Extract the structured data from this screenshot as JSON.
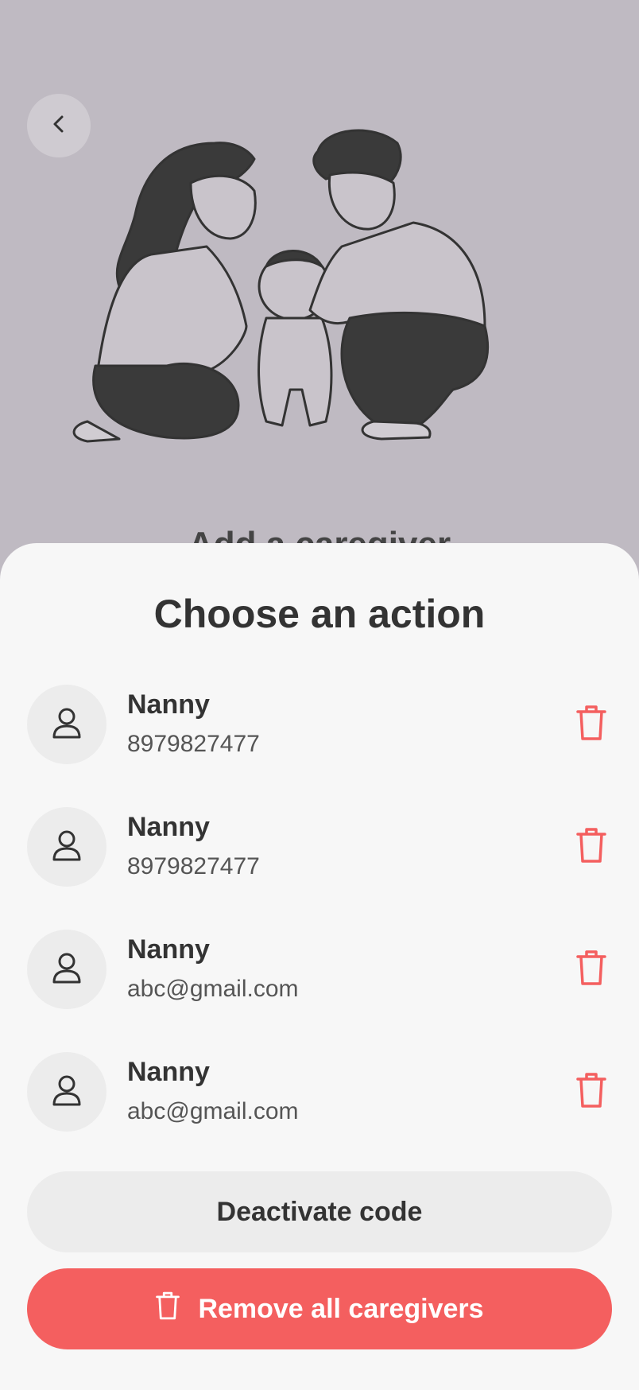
{
  "hero": {
    "background_title": "Add a caregiver"
  },
  "sheet": {
    "title": "Choose an action",
    "caregivers": [
      {
        "name": "Nanny",
        "contact": "8979827477"
      },
      {
        "name": "Nanny",
        "contact": "8979827477"
      },
      {
        "name": "Nanny",
        "contact": "abc@gmail.com"
      },
      {
        "name": "Nanny",
        "contact": "abc@gmail.com"
      }
    ],
    "deactivate_label": "Deactivate code",
    "remove_all_label": "Remove all caregivers"
  },
  "icons": {
    "back": "chevron-left-icon",
    "avatar": "user-icon",
    "delete": "trash-icon"
  },
  "colors": {
    "backdrop": "#bfbac2",
    "sheet": "#f7f7f7",
    "danger": "#f45f5f",
    "secondary_button": "#ececec",
    "text": "#333333"
  }
}
